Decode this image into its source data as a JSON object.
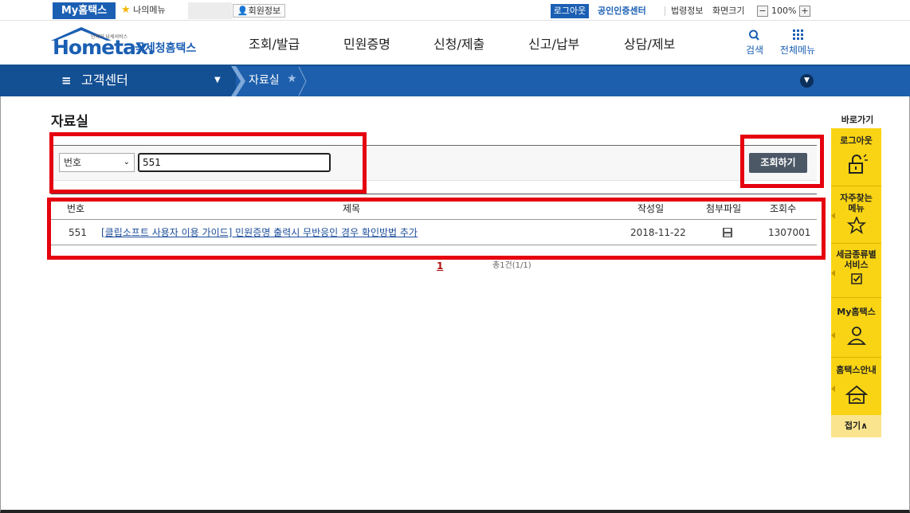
{
  "topbar": {
    "my_hometax": "My홈택스",
    "my_menu": "나의메뉴",
    "member_info": "회원정보",
    "logout": "로그아웃",
    "cert_center": "공인인증센터",
    "law_info": "법령정보",
    "screen_size": "화면크기",
    "zoom_minus": "−",
    "zoom_value": "100%",
    "zoom_plus": "+"
  },
  "header": {
    "logo_text": "Hometax.",
    "logo_tagline": "언제어 납세서비스",
    "logo_korean": "국세청홈택스",
    "gnb": [
      "조회/발급",
      "민원증명",
      "신청/제출",
      "신고/납부",
      "상담/제보"
    ],
    "search_label": "검색",
    "all_menu_label": "전체메뉴"
  },
  "navbar": {
    "section": "고객센터",
    "current": "자료실"
  },
  "content": {
    "page_title": "자료실",
    "search_select": "번호",
    "search_value": "551",
    "query_button": "조회하기",
    "table": {
      "headers": [
        "번호",
        "제목",
        "작성일",
        "첨부파일",
        "조회수"
      ],
      "rows": [
        {
          "no": "551",
          "title": "[클립소프트 사용자 이용 가이드] 민원증명 출력시 무반응인 경우 확인방법 추가",
          "date": "2018-11-22",
          "views": "1307001"
        }
      ]
    },
    "pager_current": "1",
    "pager_total": "총1건(1/1)"
  },
  "quick": {
    "title": "바로가기",
    "items": [
      {
        "label": "로그아웃",
        "icon": "unlock-icon"
      },
      {
        "label": "자주찾는\n메뉴",
        "icon": "star-icon"
      },
      {
        "label": "세금종류별\n서비스",
        "icon": "checkbox-icon"
      },
      {
        "label": "My홈택스",
        "icon": "user-icon"
      },
      {
        "label": "홈택스안내",
        "icon": "home-guide-icon"
      }
    ],
    "fold": "접기∧"
  },
  "colors": {
    "brand_blue": "#1b5fb3",
    "nav_blue": "#1d5fac",
    "highlight_red": "#e5000f",
    "quick_yellow": "#f9d414"
  }
}
